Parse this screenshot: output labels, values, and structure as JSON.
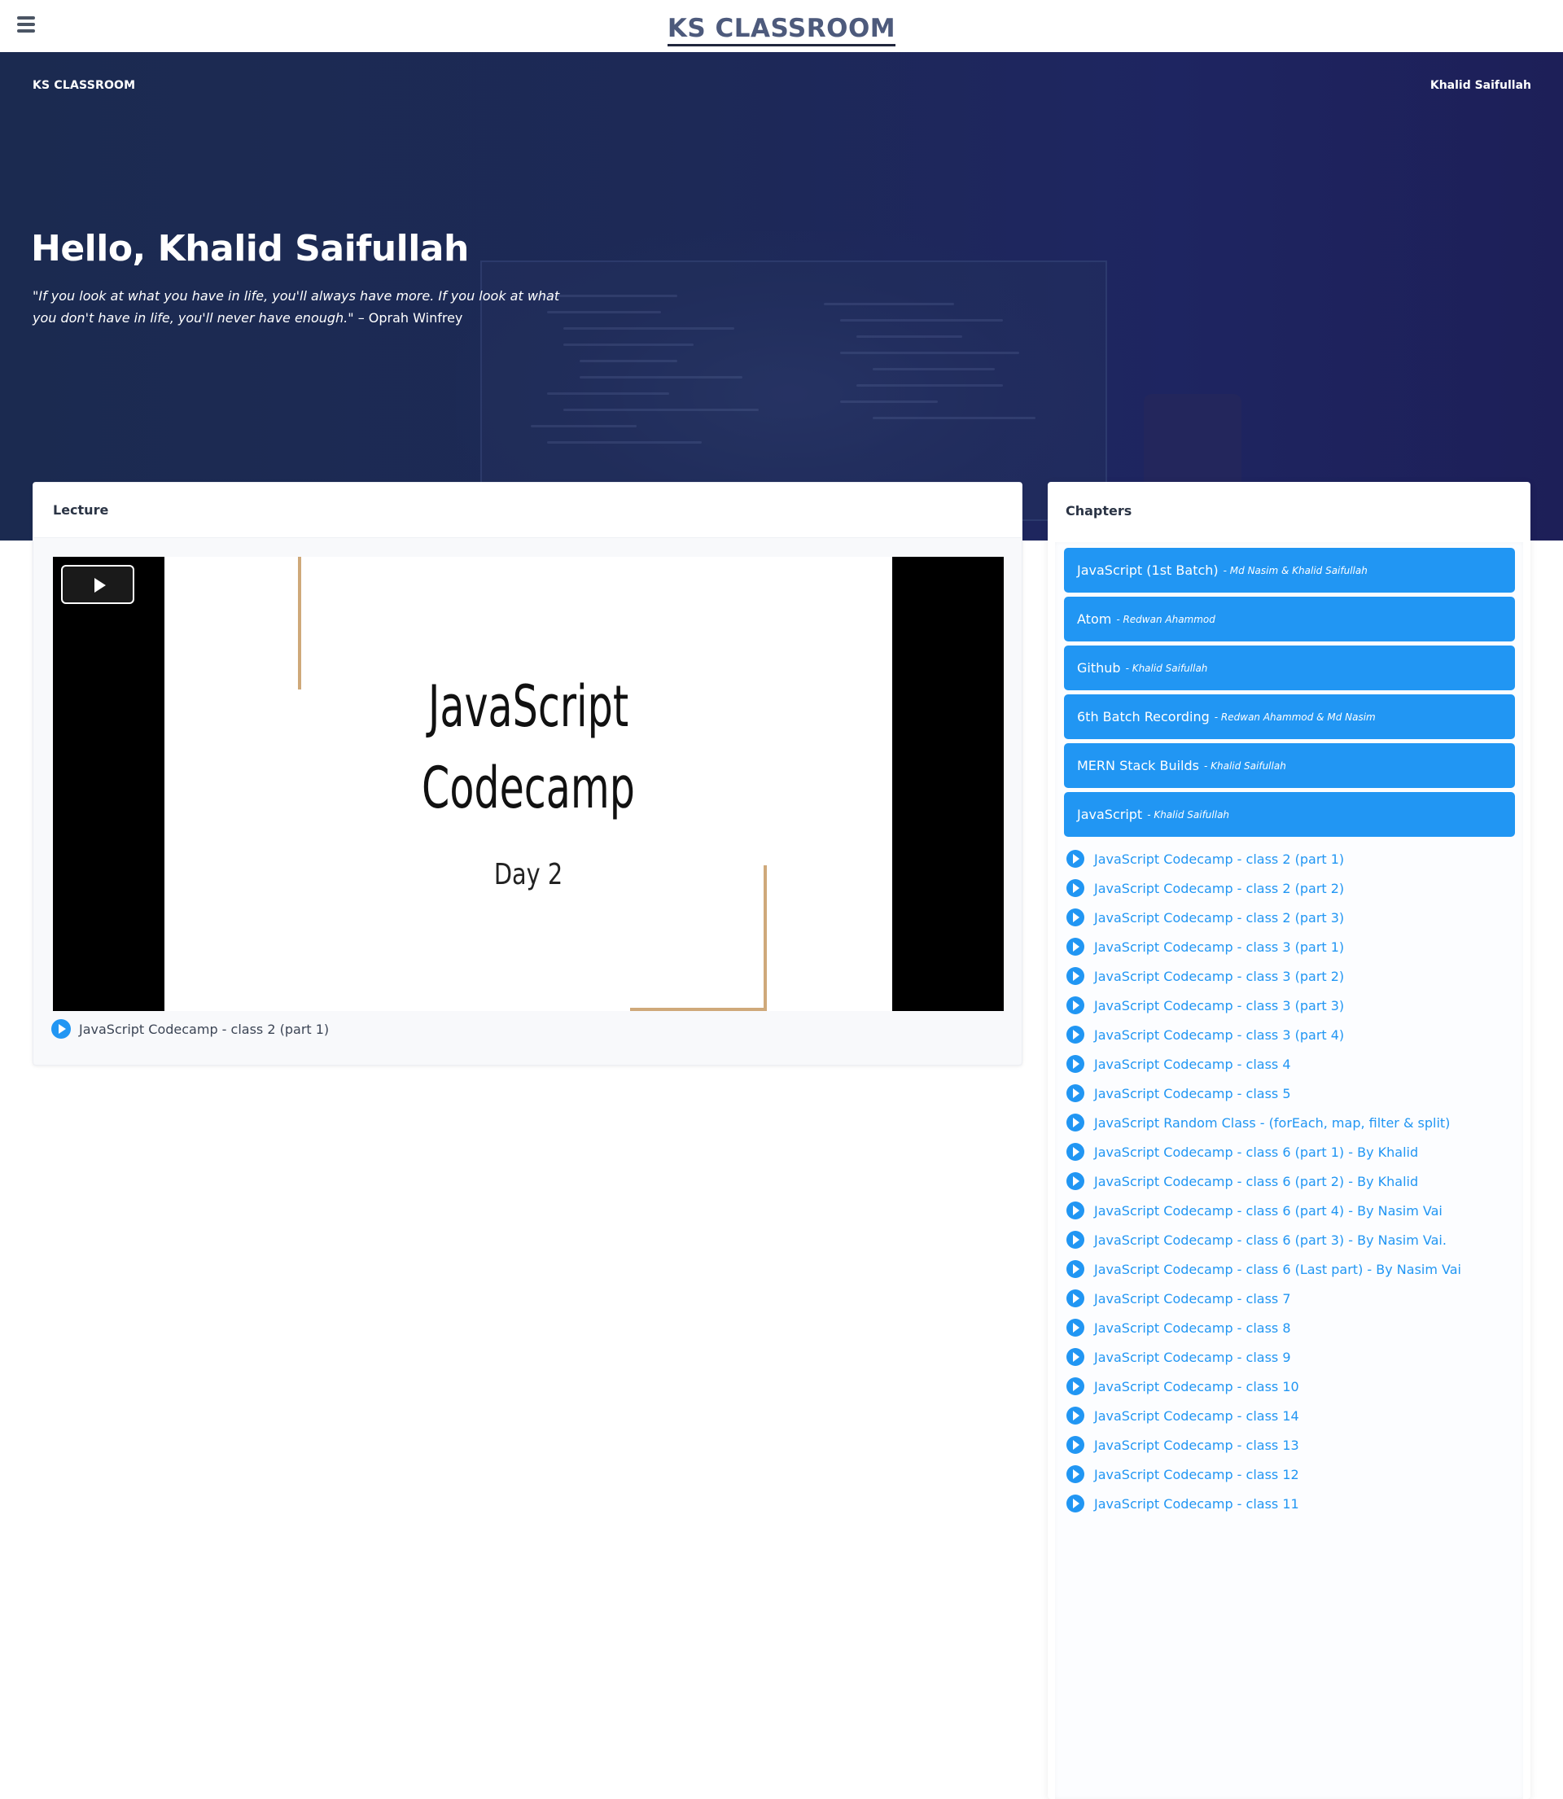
{
  "topbar": {
    "brand": "KS CLASSROOM",
    "menu_icon": "hamburger-menu-icon"
  },
  "hero": {
    "brand": "KS CLASSROOM",
    "user_name": "Khalid Saifullah",
    "greeting": "Hello, Khalid Saifullah",
    "quote": "\"If you look at what you have in life, you'll always have more. If you look at what you don't have in life, you'll never have enough.\"",
    "quote_author": " – Oprah Winfrey",
    "colors": {
      "background": "#1d2957",
      "text": "#ffffff"
    }
  },
  "lecture": {
    "title": "Lecture",
    "slide_title_line1": "JavaScript",
    "slide_title_line2": "Codecamp",
    "slide_subtitle": "Day 2",
    "play_icon": "play-icon",
    "now_playing": "JavaScript Codecamp - class 2 (part 1)"
  },
  "chapters": {
    "title": "Chapters",
    "accent_color": "#2196f3",
    "groups": [
      {
        "name": "JavaScript (1st Batch)",
        "author": "- Md Nasim & Khalid Saifullah"
      },
      {
        "name": "Atom",
        "author": "- Redwan Ahammod"
      },
      {
        "name": "Github",
        "author": "- Khalid Saifullah"
      },
      {
        "name": "6th Batch Recording",
        "author": "- Redwan Ahammod & Md Nasim"
      },
      {
        "name": "MERN Stack Builds",
        "author": "- Khalid Saifullah"
      },
      {
        "name": "JavaScript",
        "author": "- Khalid Saifullah"
      }
    ],
    "lessons": [
      "JavaScript Codecamp - class 2 (part 1)",
      "JavaScript Codecamp - class 2 (part 2)",
      "JavaScript Codecamp - class 2 (part 3)",
      "JavaScript Codecamp - class 3 (part 1)",
      "JavaScript Codecamp - class 3 (part 2)",
      "JavaScript Codecamp - class 3 (part 3)",
      "JavaScript Codecamp - class 3 (part 4)",
      "JavaScript Codecamp - class 4",
      "JavaScript Codecamp - class 5",
      "JavaScript Random Class - (forEach, map, filter & split)",
      "JavaScript Codecamp - class 6 (part 1) - By Khalid",
      "JavaScript Codecamp - class 6 (part 2) - By Khalid",
      "JavaScript Codecamp - class 6 (part 4) - By Nasim Vai",
      "JavaScript Codecamp - class 6 (part 3) - By Nasim Vai.",
      "JavaScript Codecamp - class 6 (Last part) - By Nasim Vai",
      "JavaScript Codecamp - class 7",
      "JavaScript Codecamp - class 8",
      "JavaScript Codecamp - class 9",
      "JavaScript Codecamp - class 10",
      "JavaScript Codecamp - class 14",
      "JavaScript Codecamp - class 13",
      "JavaScript Codecamp - class 12",
      "JavaScript Codecamp - class 11"
    ]
  }
}
